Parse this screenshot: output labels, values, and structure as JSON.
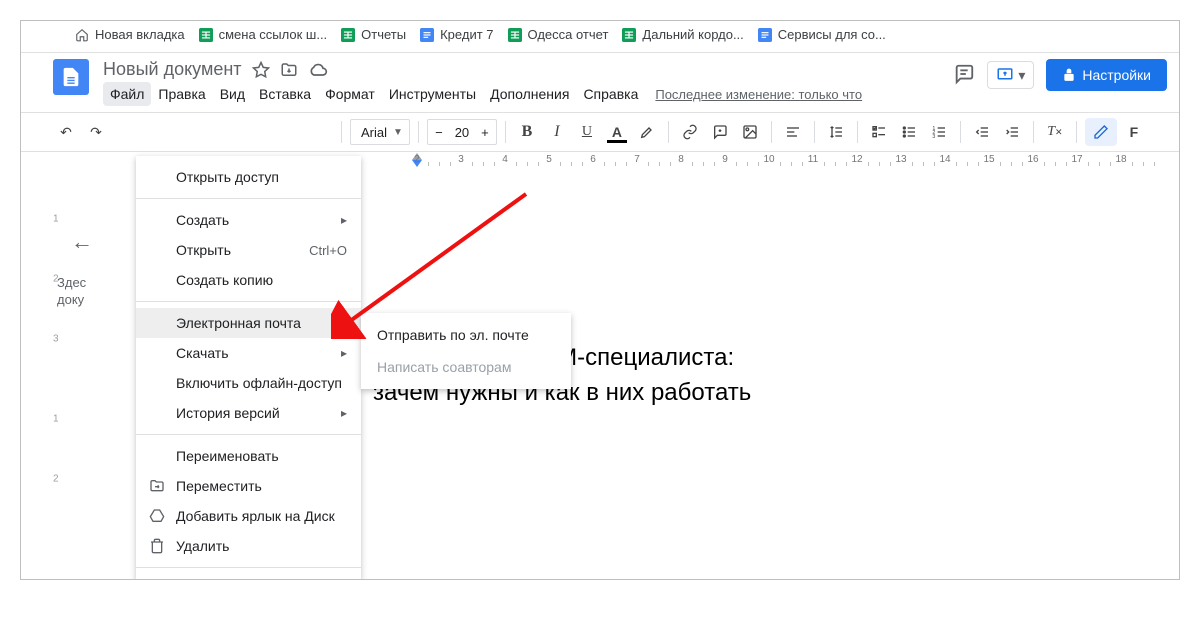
{
  "bookmarks": [
    {
      "kind": "home",
      "label": "Новая вкладка"
    },
    {
      "kind": "sheet",
      "label": "смена ссылок ш..."
    },
    {
      "kind": "sheet",
      "label": "Отчеты"
    },
    {
      "kind": "doc",
      "label": "Кредит 7"
    },
    {
      "kind": "sheet",
      "label": "Одесса отчет"
    },
    {
      "kind": "sheet",
      "label": "Дальний кордо..."
    },
    {
      "kind": "doc",
      "label": "Сервисы для со..."
    }
  ],
  "doc": {
    "title": "Новый документ",
    "last_edit": "Последнее изменение: только что",
    "settings_label": "Настройки",
    "body_line1": "кументы для SMM-специалиста:",
    "body_line2": "зачем нужны и как в них работать"
  },
  "menu": {
    "items": [
      "Файл",
      "Правка",
      "Вид",
      "Вставка",
      "Формат",
      "Инструменты",
      "Дополнения",
      "Справка"
    ],
    "active_index": 0
  },
  "toolbar": {
    "font": "Arial",
    "size": "20"
  },
  "file_menu": {
    "items": [
      {
        "label": "Открыть доступ",
        "section": 0
      },
      {
        "label": "Создать",
        "sub": true,
        "section": 1
      },
      {
        "label": "Открыть",
        "shortcut": "Ctrl+O",
        "section": 1
      },
      {
        "label": "Создать копию",
        "section": 1
      },
      {
        "label": "Электронная почта",
        "sub": true,
        "hover": true,
        "section": 2
      },
      {
        "label": "Скачать",
        "sub": true,
        "section": 2
      },
      {
        "label": "Включить офлайн-доступ",
        "section": 2
      },
      {
        "label": "История версий",
        "sub": true,
        "section": 2
      },
      {
        "label": "Переименовать",
        "section": 3
      },
      {
        "label": "Переместить",
        "icon": "move",
        "section": 3
      },
      {
        "label": "Добавить ярлык на Диск",
        "icon": "drive",
        "section": 3
      },
      {
        "label": "Удалить",
        "icon": "trash",
        "section": 3
      }
    ]
  },
  "email_submenu": {
    "send": "Отправить по эл. почте",
    "coauthors": "Написать соавторам"
  },
  "outline": {
    "here": "Здес",
    "doc": "доку"
  },
  "ruler": {
    "start": 2,
    "end": 18
  }
}
